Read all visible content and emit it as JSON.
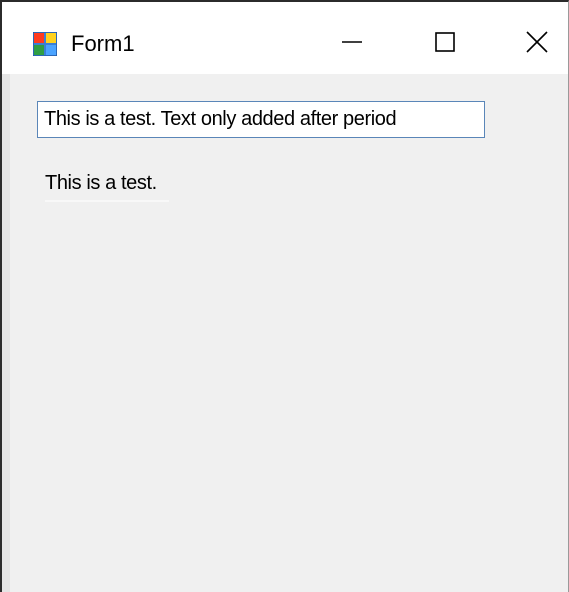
{
  "window": {
    "title": "Form1",
    "icon": "winforms-app-icon",
    "controls": {
      "minimize_icon": "minimize-icon",
      "maximize_icon": "maximize-icon",
      "close_icon": "close-icon"
    }
  },
  "form": {
    "textbox": {
      "value": "This is a test. Text only added after period",
      "placeholder": ""
    },
    "label": {
      "text": "This is a test."
    }
  },
  "colors": {
    "titlebar": "#ffffff",
    "client_background": "#f0f0f0",
    "textbox_border": "#5a86b8",
    "text": "#000000"
  }
}
